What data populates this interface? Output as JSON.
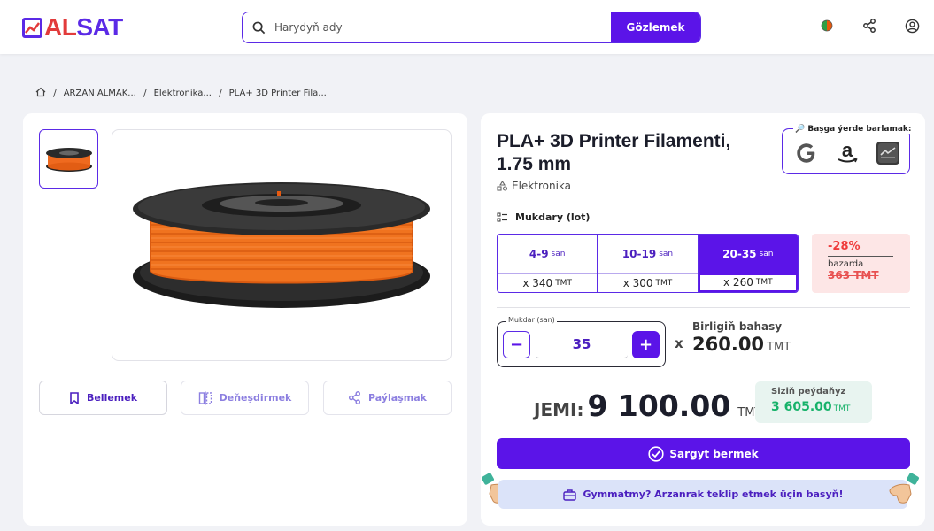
{
  "header": {
    "logo_part1": "AL",
    "logo_part2": "SAT",
    "search_placeholder": "Harydyň ady",
    "search_button": "Gözlemek",
    "accent_color": "#5b14e8"
  },
  "breadcrumb": [
    "ARZAN ALMAK...",
    "Elektronika...",
    "PLA+ 3D Printer Fila..."
  ],
  "gallery": {
    "buttons": {
      "save": "Bellemek",
      "compare": "Deňeşdirmek",
      "share": "Paýlaşmak"
    }
  },
  "product": {
    "title": "PLA+ 3D Printer Filamenti, 1.75 mm",
    "category": "Elektronika",
    "elsewhere_label": "🔎 Başga ýerde barlamak:",
    "quantity_label": "Mukdary (lot)",
    "tiers": [
      {
        "range": "4-9",
        "unit": "san",
        "price": "x 340",
        "currency": "TMT",
        "active": false
      },
      {
        "range": "10-19",
        "unit": "san",
        "price": "x 300",
        "currency": "TMT",
        "active": false
      },
      {
        "range": "20-35",
        "unit": "san",
        "price": "x 260",
        "currency": "TMT",
        "active": true
      }
    ],
    "discount": {
      "percent": "-28%",
      "label": "bazarda",
      "old_price": "363 TMT"
    },
    "quantity_field_label": "Mukdar (san)",
    "quantity_value": "35",
    "unit_price_label": "Birligiň bahasy",
    "unit_price_value": "260.00",
    "currency": "TMT",
    "times_sign": "x",
    "total_label": "JEMI:",
    "total_value": "9 100.00",
    "profit_label": "Siziň peýdaňyz",
    "profit_value": "3 605.00",
    "order_button": "Sargyt bermek",
    "offer_text": "Gymmatmy? Arzanrak teklip etmek üçin basyň!"
  }
}
